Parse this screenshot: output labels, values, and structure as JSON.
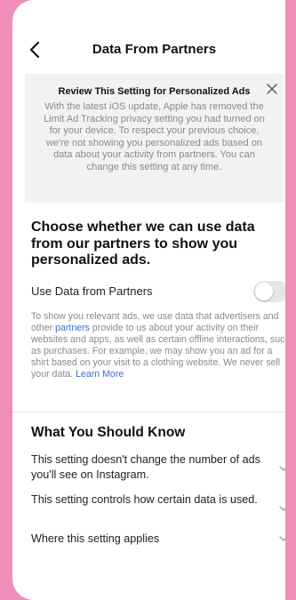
{
  "header": {
    "title": "Data From Partners"
  },
  "notice": {
    "title": "Review This Setting for Personalized Ads",
    "body": "With the latest iOS update, Apple has removed the Limit Ad Tracking privacy setting you had turned on for your device. To respect your previous choice, we're not showing you personalized ads based on data about your activity from partners. You can change this setting at any time."
  },
  "section": {
    "heading": "Choose whether we can use data from our partners to show you personalized ads.",
    "setting_label": "Use Data from Partners",
    "toggle_on": false,
    "description_before": "To show you relevant ads, we use data that advertisers and other ",
    "partners_link": "partners",
    "description_after": " provide to us about your activity on their websites and apps, as well as certain offline interactions, such as purchases. For example, we may show you an ad for a shirt based on your visit to a clothing website. We never sell your data. ",
    "learn_more": "Learn More"
  },
  "know": {
    "heading": "What You Should Know",
    "items": [
      {
        "label": "This setting doesn't change the number of ads you'll see on Instagram."
      },
      {
        "label": "This setting controls how certain data is used."
      },
      {
        "label": "Where this setting applies"
      }
    ]
  },
  "colors": {
    "background": "#f08db8",
    "link": "#3b6fd6",
    "muted_text": "#8a8a8a",
    "notice_bg": "#f2f2f2"
  },
  "icons": {
    "back": "chevron-left-icon",
    "close": "close-icon",
    "expand": "chevron-down-icon"
  }
}
